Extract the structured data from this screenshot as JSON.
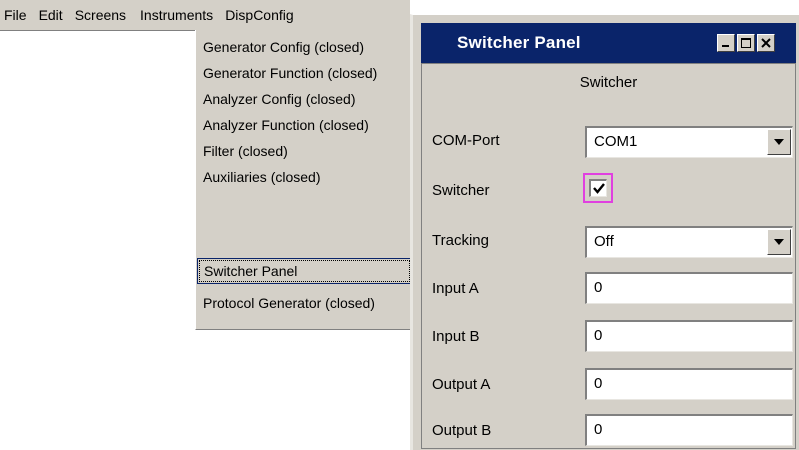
{
  "menubar": {
    "items": [
      "File",
      "Edit",
      "Screens",
      "Instruments",
      "DispConfig"
    ]
  },
  "dropdown": {
    "items": [
      "Generator Config (closed)",
      "Generator Function (closed)",
      "Analyzer Config (closed)",
      "Analyzer Function (closed)",
      "Filter (closed)",
      "Auxiliaries (closed)",
      "Switcher Panel",
      "Protocol Generator (closed)"
    ],
    "selected_index": 6
  },
  "panel": {
    "title": "Switcher Panel",
    "section": "Switcher",
    "com_port": {
      "label": "COM-Port",
      "value": "COM1"
    },
    "switcher": {
      "label": "Switcher",
      "checked": true
    },
    "tracking": {
      "label": "Tracking",
      "value": "Off"
    },
    "input_a": {
      "label": "Input A",
      "value": "0"
    },
    "input_b": {
      "label": "Input B",
      "value": "0"
    },
    "output_a": {
      "label": "Output A",
      "value": "0"
    },
    "output_b": {
      "label": "Output B",
      "value": "0"
    }
  },
  "icons": {
    "minimize": "minimize-icon",
    "maximize": "maximize-icon",
    "close": "close-icon",
    "dropdown": "triangle-down-icon",
    "check": "checkmark-icon"
  },
  "colors": {
    "titlebar": "#0a246a",
    "face": "#d4d0c8",
    "focus_border": "#e040e0"
  }
}
